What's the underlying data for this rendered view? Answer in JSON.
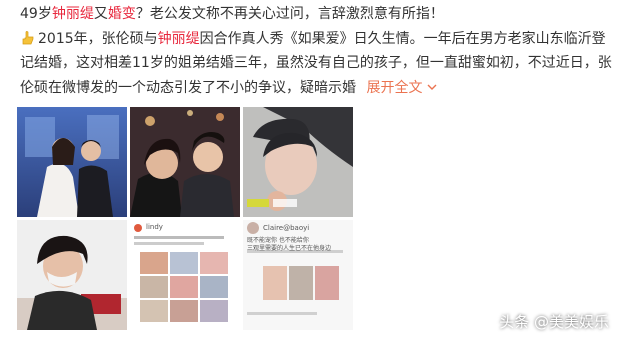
{
  "post": {
    "line1": {
      "a": "49岁",
      "b": "钟丽缇",
      "c": "又",
      "d": "婚变",
      "e": "？老公发文称不再关心过问，言辞激烈意有所指！"
    },
    "line2": {
      "icon": "hand-point-icon",
      "a": "2015年，张伦硕与",
      "b": "钟丽缇",
      "c": "因合作真人秀《如果爱》日久生情。一年后在男方老家山东临沂登"
    },
    "line3": "记结婚，这对相差11岁的姐弟结婚三年，虽然没有自己的孩子，但一直甜蜜如初，不过近日，张",
    "line4": "伦硕在微博发的一个动态引发了不小的争议，疑暗示婚",
    "more_label": "展开全文",
    "more_icon": "chevron-down-icon"
  },
  "images": {
    "img4_caption": "lindy",
    "img6_caption": "Claire@baoyi",
    "img6_sub1": "既不能宠你 也不能给你",
    "img6_sub2": "三观里需要的人生已不在他身边"
  },
  "watermark": "头条 @美美娱乐",
  "colors": {
    "highlight": "#e8283d",
    "more": "#eb7350"
  }
}
